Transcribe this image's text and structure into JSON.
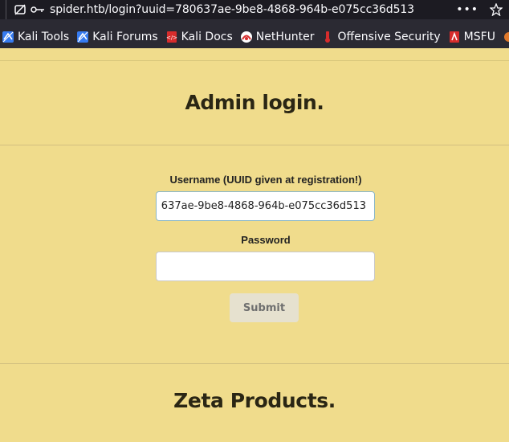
{
  "browser": {
    "url": "spider.htb/login?uuid=780637ae-9be8-4868-964b-e075cc36d513",
    "more_label": "•••",
    "bookmarks": [
      {
        "label": "Kali Tools",
        "icon": "kali-icon"
      },
      {
        "label": "Kali Forums",
        "icon": "kali-icon"
      },
      {
        "label": "Kali Docs",
        "icon": "kali-docs-icon"
      },
      {
        "label": "NetHunter",
        "icon": "nethunter-icon"
      },
      {
        "label": "Offensive Security",
        "icon": "offsec-icon"
      },
      {
        "label": "MSFU",
        "icon": "msfu-icon"
      }
    ]
  },
  "page": {
    "heading": "Admin login.",
    "form": {
      "username_label": "Username (UUID given at registration!)",
      "username_value": "637ae-9be8-4868-964b-e075cc36d513",
      "password_label": "Password",
      "password_value": "",
      "submit_label": "Submit"
    },
    "section_heading": "Zeta Products."
  },
  "colors": {
    "page_bg": "#f0dc8c",
    "toolbar_bg": "#1c1b22",
    "bookmarks_bg": "#2b2a33"
  }
}
